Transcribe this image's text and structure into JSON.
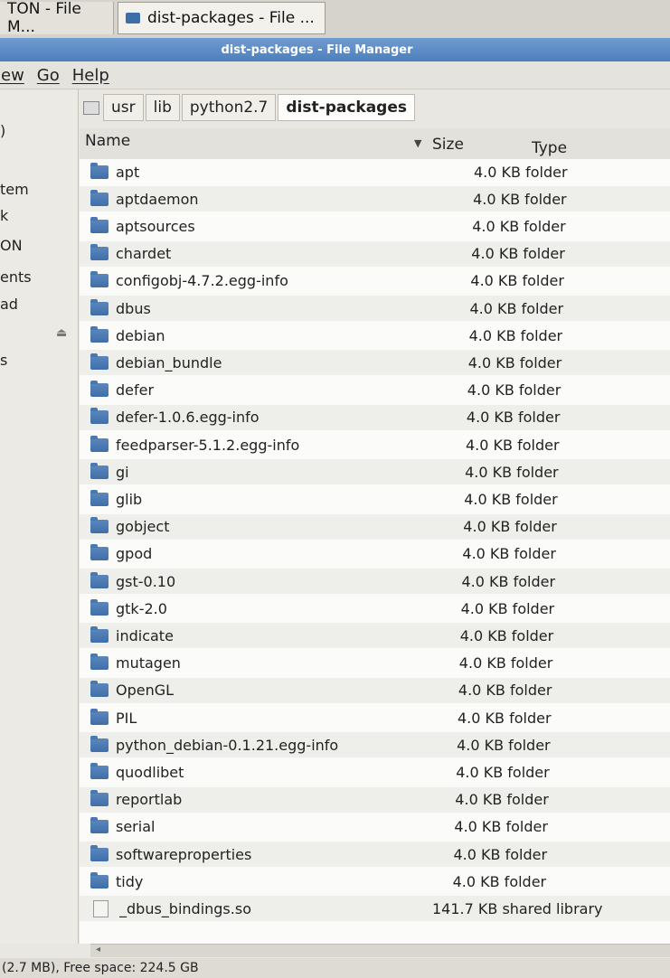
{
  "taskbar": {
    "tabs": [
      {
        "label": "TON - File M..."
      },
      {
        "label": "dist-packages - File ..."
      }
    ]
  },
  "window": {
    "title": "dist-packages - File Manager"
  },
  "menubar": {
    "items": [
      "iew",
      "Go",
      "Help"
    ]
  },
  "sidebar": {
    "items": [
      {
        "label": ")"
      },
      {
        "label": "tem"
      },
      {
        "label": "k"
      },
      {
        "label": "ON"
      },
      {
        "label": "ents"
      },
      {
        "label": "ad"
      },
      {
        "label": "s"
      }
    ]
  },
  "pathbar": {
    "crumbs": [
      "usr",
      "lib",
      "python2.7",
      "dist-packages"
    ]
  },
  "columns": {
    "name": "Name",
    "size": "Size",
    "type": "Type"
  },
  "files": [
    {
      "name": "apt",
      "size_type": "4.0 KB folder",
      "kind": "folder"
    },
    {
      "name": "aptdaemon",
      "size_type": "4.0 KB folder",
      "kind": "folder"
    },
    {
      "name": "aptsources",
      "size_type": "4.0 KB folder",
      "kind": "folder"
    },
    {
      "name": "chardet",
      "size_type": "4.0 KB folder",
      "kind": "folder"
    },
    {
      "name": "configobj-4.7.2.egg-info",
      "size_type": "4.0 KB folder",
      "kind": "folder"
    },
    {
      "name": "dbus",
      "size_type": "4.0 KB folder",
      "kind": "folder"
    },
    {
      "name": "debian",
      "size_type": "4.0 KB folder",
      "kind": "folder"
    },
    {
      "name": "debian_bundle",
      "size_type": "4.0 KB folder",
      "kind": "folder"
    },
    {
      "name": "defer",
      "size_type": "4.0 KB folder",
      "kind": "folder"
    },
    {
      "name": "defer-1.0.6.egg-info",
      "size_type": "4.0 KB folder",
      "kind": "folder"
    },
    {
      "name": "feedparser-5.1.2.egg-info",
      "size_type": "4.0 KB folder",
      "kind": "folder"
    },
    {
      "name": "gi",
      "size_type": "4.0 KB folder",
      "kind": "folder"
    },
    {
      "name": "glib",
      "size_type": "4.0 KB folder",
      "kind": "folder"
    },
    {
      "name": "gobject",
      "size_type": "4.0 KB folder",
      "kind": "folder"
    },
    {
      "name": "gpod",
      "size_type": "4.0 KB folder",
      "kind": "folder"
    },
    {
      "name": "gst-0.10",
      "size_type": "4.0 KB folder",
      "kind": "folder"
    },
    {
      "name": "gtk-2.0",
      "size_type": "4.0 KB folder",
      "kind": "folder"
    },
    {
      "name": "indicate",
      "size_type": "4.0 KB folder",
      "kind": "folder"
    },
    {
      "name": "mutagen",
      "size_type": "4.0 KB folder",
      "kind": "folder"
    },
    {
      "name": "OpenGL",
      "size_type": "4.0 KB folder",
      "kind": "folder"
    },
    {
      "name": "PIL",
      "size_type": "4.0 KB folder",
      "kind": "folder"
    },
    {
      "name": "python_debian-0.1.21.egg-info",
      "size_type": "4.0 KB folder",
      "kind": "folder"
    },
    {
      "name": "quodlibet",
      "size_type": "4.0 KB folder",
      "kind": "folder"
    },
    {
      "name": "reportlab",
      "size_type": "4.0 KB folder",
      "kind": "folder"
    },
    {
      "name": "serial",
      "size_type": "4.0 KB folder",
      "kind": "folder"
    },
    {
      "name": "softwareproperties",
      "size_type": "4.0 KB folder",
      "kind": "folder"
    },
    {
      "name": "tidy",
      "size_type": "4.0 KB folder",
      "kind": "folder"
    },
    {
      "name": "_dbus_bindings.so",
      "size_type": "141.7 KB shared library",
      "kind": "file"
    }
  ],
  "statusbar": {
    "text": "(2.7 MB), Free space: 224.5 GB"
  }
}
